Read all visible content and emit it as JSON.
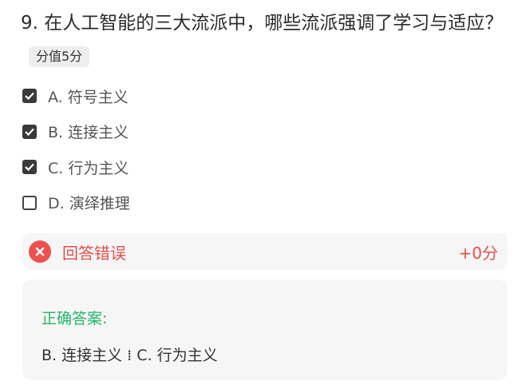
{
  "question": {
    "text": "9. 在人工智能的三大流派中，哪些流派强调了学习与适应？",
    "score_badge": "分值5分"
  },
  "options": [
    {
      "label": "A. 符号主义",
      "checked": true
    },
    {
      "label": "B. 连接主义",
      "checked": true
    },
    {
      "label": "C. 行为主义",
      "checked": true
    },
    {
      "label": "D. 演绎推理",
      "checked": false
    }
  ],
  "result": {
    "icon": "close-icon",
    "text": "回答错误",
    "score": "+0分"
  },
  "answer": {
    "title": "正确答案:",
    "value": "B. 连接主义 ⁞ C. 行为主义"
  },
  "colors": {
    "error": "#e2504a",
    "error_icon_bg": "#ee5050",
    "correct_title": "#28b36b",
    "checkbox": "#3a3a3a",
    "panel_bg": "#f6f6f6"
  }
}
